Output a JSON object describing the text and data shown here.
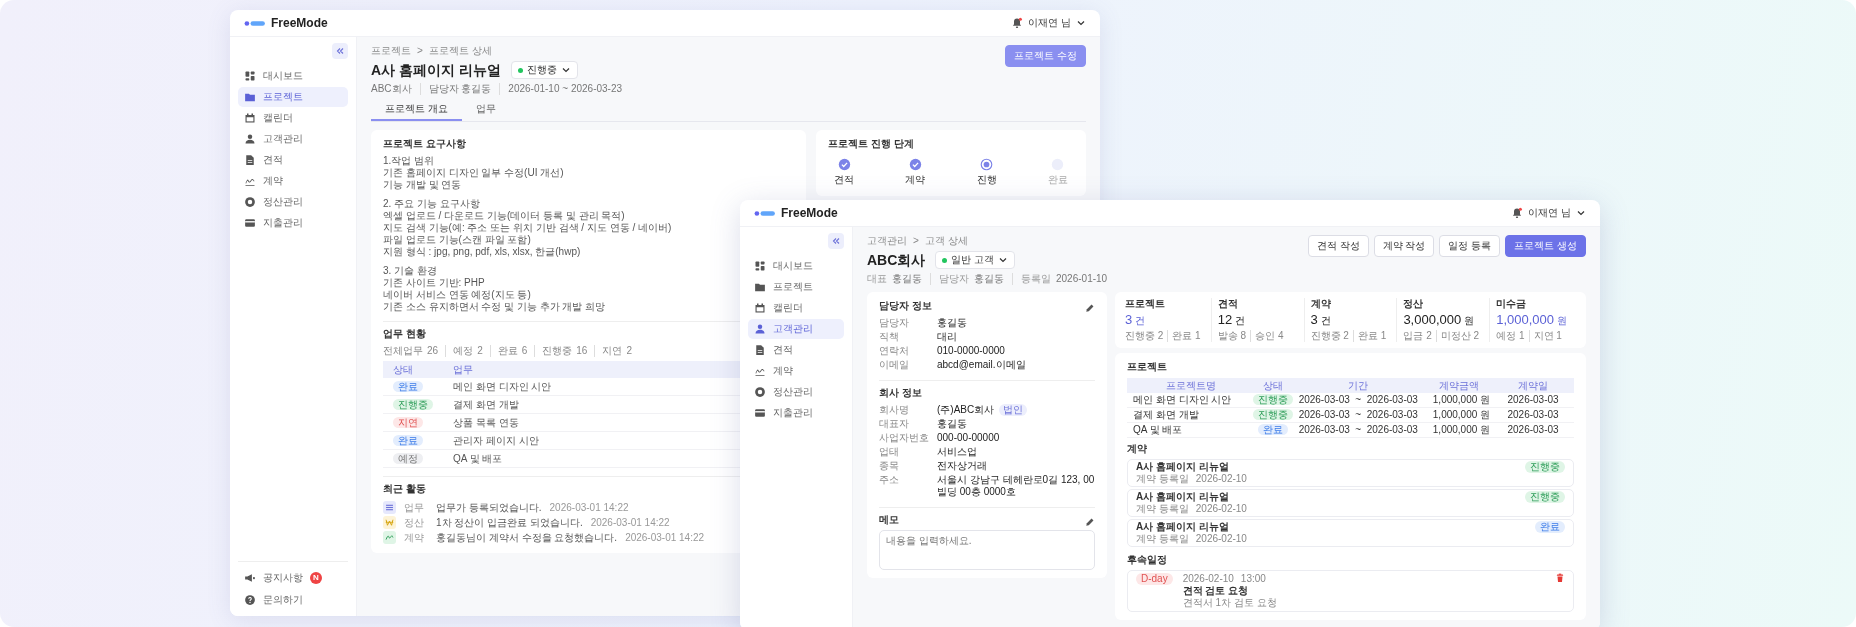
{
  "back_window": {
    "logo": "FreeMode",
    "user": "이재연 님",
    "sidebar": {
      "items": [
        {
          "label": "대시보드",
          "kind": "dashboard",
          "selected": false
        },
        {
          "label": "프로젝트",
          "kind": "project",
          "selected": true
        },
        {
          "label": "캘린더",
          "kind": "calendar",
          "selected": false
        },
        {
          "label": "고객관리",
          "kind": "customer",
          "selected": false
        },
        {
          "label": "견적",
          "kind": "estimate",
          "selected": false
        },
        {
          "label": "계약",
          "kind": "contract",
          "selected": false
        },
        {
          "label": "정산관리",
          "kind": "settlement",
          "selected": false
        },
        {
          "label": "지출관리",
          "kind": "expense",
          "selected": false
        }
      ],
      "footer_items": [
        {
          "label": "공지사항",
          "kind": "notice",
          "badge": "N"
        },
        {
          "label": "문의하기",
          "kind": "inquiry"
        }
      ]
    },
    "breadcrumb": {
      "items": [
        "프로젝트",
        "프로젝트 상세"
      ],
      "separator": ">"
    },
    "title": "A사 홈페이지 리뉴얼",
    "status": {
      "label": "진행중",
      "color": "#22c55e"
    },
    "meta": [
      "ABC회사",
      "담당자 홍길동",
      "2026-01-10 ~ 2026-03-23"
    ],
    "edit_button": "프로젝트 수정",
    "tabs": [
      {
        "label": "프로젝트 개요",
        "selected": true
      },
      {
        "label": "업무",
        "selected": false
      }
    ],
    "requirements": {
      "title": "프로젝트 요구사항",
      "sections": [
        {
          "heading": "1.작업 범위",
          "lines": [
            "기존 홈페이지 디자인 일부 수정(UI 개선)",
            "기능 개발 및 연동"
          ]
        },
        {
          "heading": "2. 주요 기능 요구사항",
          "lines": [
            "엑셀 업로드 / 다운로드 기능(데이터 등록 및 관리 목적)",
            "지도 검색 기능(예: 주소 또는 위치 기반 검색 / 지도 연동 / 네이버)",
            "파일 업로드 기능(스캔 파일 포함)",
            "지원 형식 : jpg, png, pdf, xls, xlsx, 한글(hwp)"
          ]
        },
        {
          "heading": "3. 기술 환경",
          "lines": [
            "기존 사이트 기반: PHP",
            "네이버 서비스 연동 예정(지도 등)",
            "기존 소스 유지하면서 수정 및 기능 추가 개발 희망"
          ]
        }
      ]
    },
    "tasks": {
      "title": "업무 현황",
      "stats": [
        {
          "label": "전체업무",
          "value": "26"
        },
        {
          "label": "예정",
          "value": "2"
        },
        {
          "label": "완료",
          "value": "6"
        },
        {
          "label": "진행중",
          "value": "16"
        },
        {
          "label": "지연",
          "value": "2"
        }
      ],
      "columns": [
        "상태",
        "업무"
      ],
      "rows": [
        {
          "status": "완료",
          "kind": "done",
          "task": "메인 화면 디자인 시안"
        },
        {
          "status": "진행중",
          "kind": "progress",
          "task": "결제 화면 개발"
        },
        {
          "status": "지연",
          "kind": "delayed",
          "task": "상품 목록 연동"
        },
        {
          "status": "완료",
          "kind": "done",
          "task": "관리자 페이지 시안"
        },
        {
          "status": "예정",
          "kind": "planned",
          "task": "QA 및 배포"
        }
      ]
    },
    "activity": {
      "title": "최근 활동",
      "items": [
        {
          "kind": "task",
          "category": "업무",
          "message": "업무가 등록되었습니다.",
          "time": "2026-03-01  14:22"
        },
        {
          "kind": "settlement",
          "category": "정산",
          "message": "1차 정산이 입금완료 되었습니다.",
          "time": "2026-03-01  14:22"
        },
        {
          "kind": "contract",
          "category": "계약",
          "message": "홍길동님이 계약서 수정을 요청했습니다.",
          "time": "2026-03-01  14:22"
        }
      ]
    },
    "progress": {
      "title": "프로젝트 진행 단계",
      "steps": [
        {
          "label": "견적",
          "done": true,
          "current": false
        },
        {
          "label": "계약",
          "done": true,
          "current": false
        },
        {
          "label": "진행",
          "done": false,
          "current": true
        },
        {
          "label": "완료",
          "done": false,
          "current": false
        }
      ]
    }
  },
  "front_window": {
    "logo": "FreeMode",
    "user": "이재연 님",
    "sidebar": {
      "items": [
        {
          "label": "대시보드",
          "kind": "dashboard",
          "selected": false
        },
        {
          "label": "프로젝트",
          "kind": "project",
          "selected": false
        },
        {
          "label": "캘린더",
          "kind": "calendar",
          "selected": false
        },
        {
          "label": "고객관리",
          "kind": "customer",
          "selected": true
        },
        {
          "label": "견적",
          "kind": "estimate",
          "selected": false
        },
        {
          "label": "계약",
          "kind": "contract",
          "selected": false
        },
        {
          "label": "정산관리",
          "kind": "settlement",
          "selected": false
        },
        {
          "label": "지출관리",
          "kind": "expense",
          "selected": false
        }
      ]
    },
    "breadcrumb": {
      "items": [
        "고객관리",
        "고객 상세"
      ],
      "separator": ">"
    },
    "title": "ABC회사",
    "grade": {
      "label": "일반 고객",
      "color": "#22c55e"
    },
    "meta": [
      {
        "label": "대표",
        "value": "홍길동"
      },
      {
        "label": "담당자",
        "value": "홍길동"
      },
      {
        "label": "등록일",
        "value": "2026-01-10"
      }
    ],
    "actions": [
      {
        "label": "견적 작성",
        "kind": "secondary"
      },
      {
        "label": "계약 작성",
        "kind": "secondary"
      },
      {
        "label": "일정 등록",
        "kind": "secondary"
      },
      {
        "label": "프로젝트 생성",
        "kind": "primary"
      }
    ],
    "contact": {
      "title": "담당자 정보",
      "fields": [
        {
          "label": "담당자",
          "value": "홍길동"
        },
        {
          "label": "직책",
          "value": "대리"
        },
        {
          "label": "연락처",
          "value": "010-0000-0000"
        },
        {
          "label": "이메일",
          "value": "abcd@email.이메일"
        }
      ]
    },
    "company": {
      "title": "회사 정보",
      "fields": [
        {
          "label": "회사명",
          "value": "(주)ABC회사",
          "badge": "법인"
        },
        {
          "label": "대표자",
          "value": "홍길동"
        },
        {
          "label": "사업자번호",
          "value": "000-00-00000"
        },
        {
          "label": "업태",
          "value": "서비스업"
        },
        {
          "label": "종목",
          "value": "전자상거래"
        },
        {
          "label": "주소",
          "value": "서울시 강남구 테헤란로0길 123, 00빌딩 00층 0000호"
        }
      ]
    },
    "memo": {
      "title": "메모",
      "placeholder": "내용을 입력하세요."
    },
    "stats": [
      {
        "label": "프로젝트",
        "value": "3",
        "unit": "건",
        "highlight": true,
        "details": [
          "진행중 2",
          "완료 1"
        ]
      },
      {
        "label": "견적",
        "value": "12",
        "unit": "건",
        "highlight": false,
        "details": [
          "발송 8",
          "승인 4"
        ]
      },
      {
        "label": "계약",
        "value": "3",
        "unit": "건",
        "highlight": false,
        "details": [
          "진행중 2",
          "완료 1"
        ]
      },
      {
        "label": "정산",
        "value": "3,000,000",
        "unit": "원",
        "highlight": false,
        "details": [
          "입금 2",
          "미정산 2"
        ]
      },
      {
        "label": "미수금",
        "value": "1,000,000",
        "unit": "원",
        "highlight": true,
        "details": [
          "예정 1",
          "지연 1"
        ]
      }
    ],
    "projects": {
      "title": "프로젝트",
      "columns": [
        "프로젝트명",
        "상태",
        "기간",
        "계약금액",
        "계약일"
      ],
      "rows": [
        {
          "name": "메인 화면 디자인 시안",
          "status": "진행중",
          "kind": "progress",
          "period": "2026-03-03  ~  2026-03-03",
          "amount": "1,000,000 원",
          "date": "2026-03-03"
        },
        {
          "name": "결제 화면 개발",
          "status": "진행중",
          "kind": "progress",
          "period": "2026-03-03  ~  2026-03-03",
          "amount": "1,000,000 원",
          "date": "2026-03-03"
        },
        {
          "name": "QA 및 배포",
          "status": "완료",
          "kind": "done",
          "period": "2026-03-03  ~  2026-03-03",
          "amount": "1,000,000 원",
          "date": "2026-03-03"
        }
      ]
    },
    "contracts": {
      "title": "계약",
      "items": [
        {
          "title": "A사 홈페이지 리뉴얼",
          "date_label": "계약 등록일",
          "date": "2026-02-10",
          "status": "진행중",
          "kind": "progress"
        },
        {
          "title": "A사 홈페이지 리뉴얼",
          "date_label": "계약 등록일",
          "date": "2026-02-10",
          "status": "진행중",
          "kind": "progress"
        },
        {
          "title": "A사 홈페이지 리뉴얼",
          "date_label": "계약 등록일",
          "date": "2026-02-10",
          "status": "완료",
          "kind": "done"
        }
      ]
    },
    "followups": {
      "title": "후속일정",
      "items": [
        {
          "badge": "D-day",
          "date": "2026-02-10",
          "time": "13:00",
          "title": "견적 검토 요청",
          "note": "견적서 1차 검토 요청"
        }
      ]
    }
  }
}
